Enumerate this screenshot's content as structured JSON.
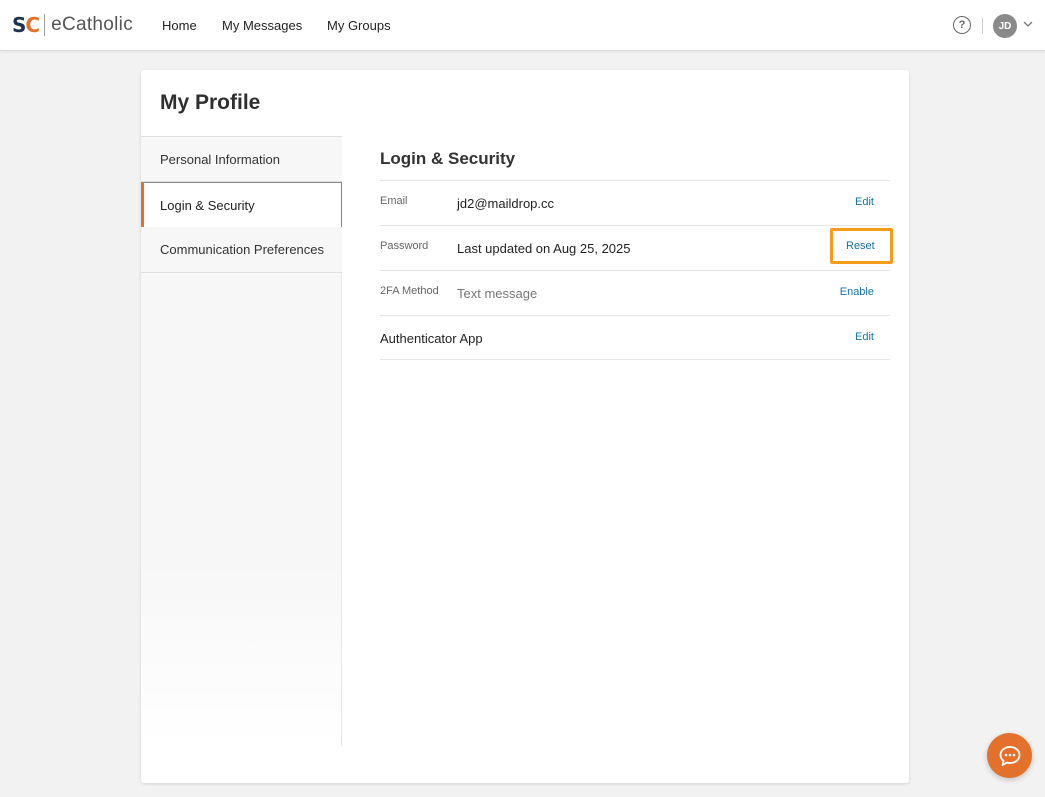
{
  "brand": {
    "mark_s": "S",
    "mark_c": "C",
    "name": "eCatholic"
  },
  "nav": {
    "home": "Home",
    "messages": "My Messages",
    "groups": "My Groups"
  },
  "header": {
    "help_glyph": "?",
    "avatar_initials": "JD"
  },
  "page": {
    "title": "My Profile"
  },
  "sidebar": {
    "items": [
      {
        "label": "Personal Information"
      },
      {
        "label": "Login & Security"
      },
      {
        "label": "Communication Preferences"
      }
    ]
  },
  "section": {
    "title": "Login & Security",
    "rows": [
      {
        "label": "Email",
        "value": "jd2@maildrop.cc",
        "action": "Edit"
      },
      {
        "label": "Password",
        "value": "Last updated on Aug 25, 2025",
        "action": "Reset"
      },
      {
        "label": "2FA Method",
        "value": "Text message",
        "action": "Enable"
      },
      {
        "label": "Authenticator App",
        "value": "",
        "action": "Edit"
      }
    ]
  },
  "colors": {
    "accent": "#e4712b",
    "link": "#1572a8",
    "highlight": "#f59c1a"
  }
}
